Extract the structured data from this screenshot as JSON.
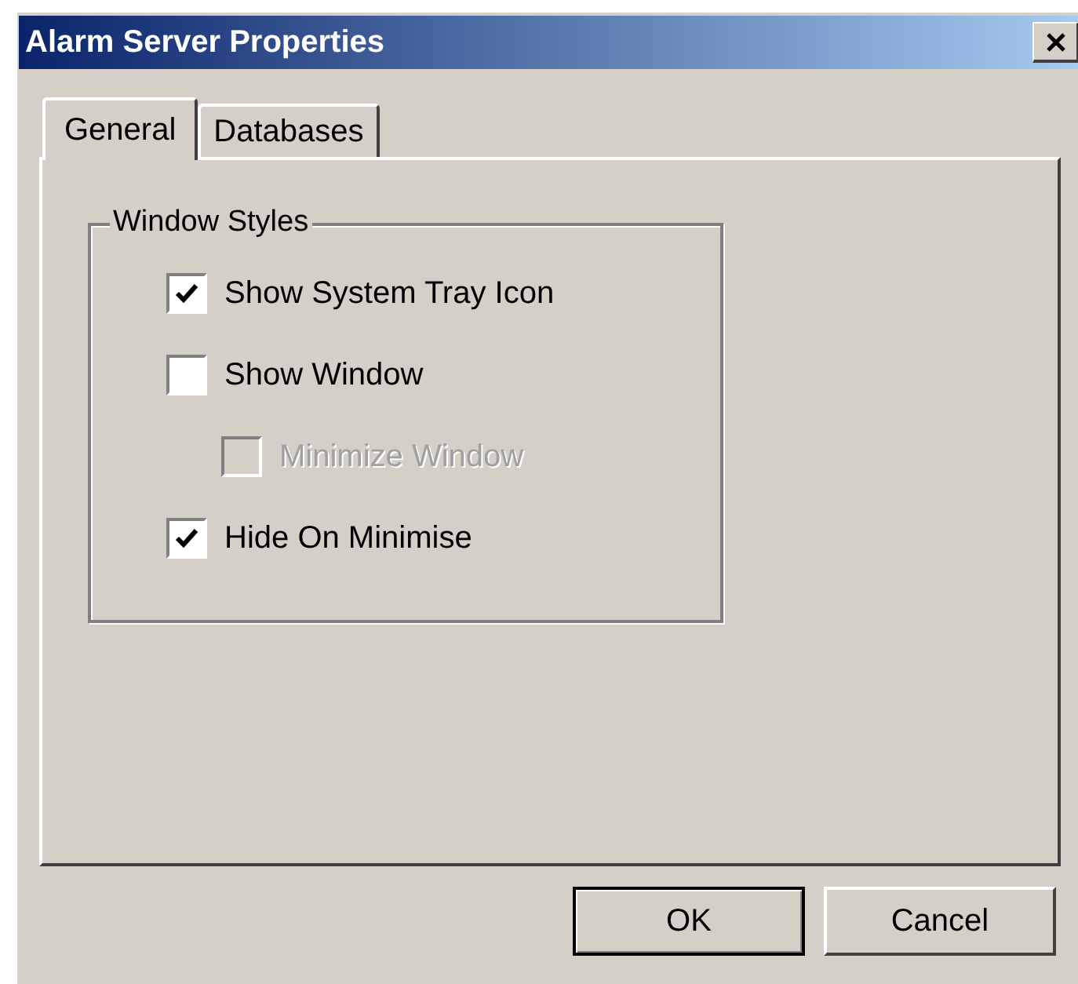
{
  "window": {
    "title": "Alarm Server Properties"
  },
  "tabs": [
    {
      "label": "General",
      "selected": true
    },
    {
      "label": "Databases",
      "selected": false
    }
  ],
  "group": {
    "title": "Window Styles",
    "options": [
      {
        "label": "Show System Tray Icon",
        "checked": true,
        "disabled": false
      },
      {
        "label": "Show Window",
        "checked": false,
        "disabled": false,
        "children": [
          {
            "label": "Minimize Window",
            "checked": false,
            "disabled": true
          }
        ]
      },
      {
        "label": "Hide On Minimise",
        "checked": true,
        "disabled": false
      }
    ]
  },
  "buttons": [
    {
      "label": "OK",
      "default": true
    },
    {
      "label": "Cancel",
      "default": false
    }
  ]
}
